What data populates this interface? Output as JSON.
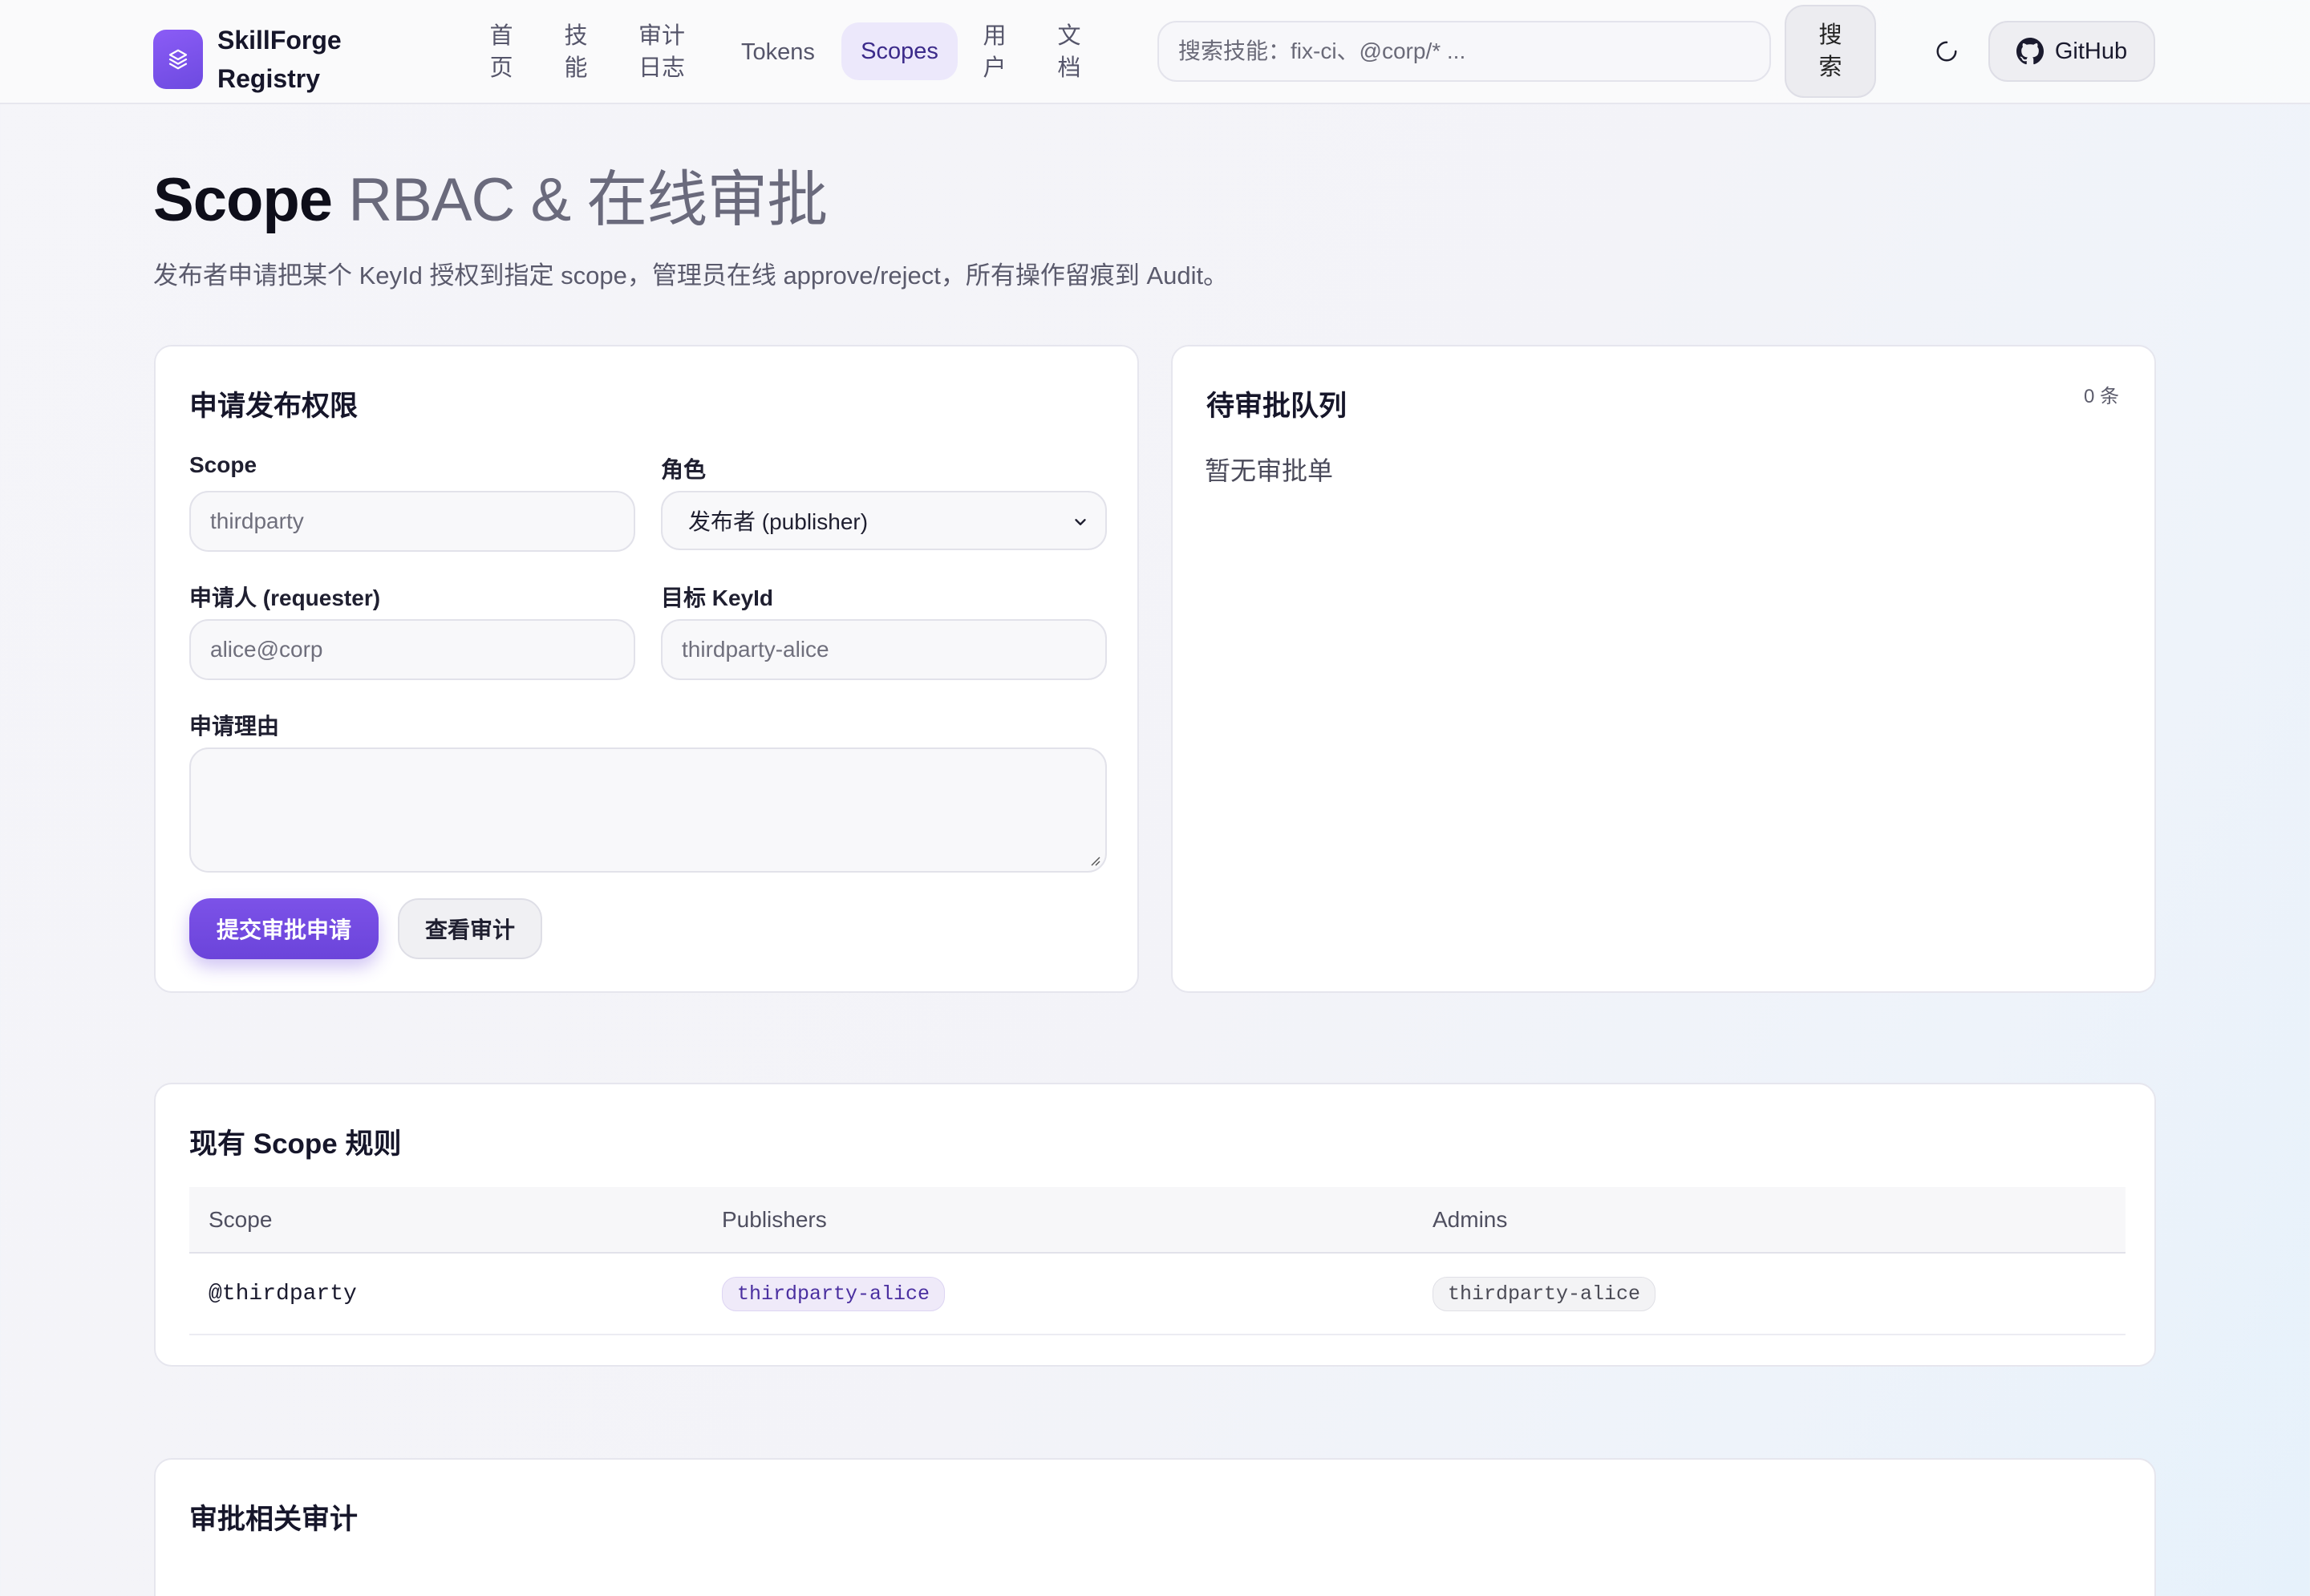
{
  "header": {
    "brand_name": "SkillForge\nRegistry",
    "nav": [
      {
        "label": "首\n页",
        "active": false
      },
      {
        "label": "技\n能",
        "active": false
      },
      {
        "label": "审计\n日志",
        "active": false
      },
      {
        "label": "Tokens",
        "active": false
      },
      {
        "label": "Scopes",
        "active": true
      },
      {
        "label": "用\n户",
        "active": false
      },
      {
        "label": "文\n档",
        "active": false
      }
    ],
    "search_placeholder": "搜索技能：fix-ci、@corp/* ...",
    "search_button": "搜\n索",
    "github_label": "GitHub"
  },
  "page": {
    "title_strong": "Scope",
    "title_light": " RBAC & 在线审批",
    "subtitle": "发布者申请把某个 KeyId 授权到指定 scope，管理员在线 approve/reject，所有操作留痕到 Audit。"
  },
  "request_form": {
    "title": "申请发布权限",
    "scope_label": "Scope",
    "scope_placeholder": "thirdparty",
    "role_label": "角色",
    "role_selected": "发布者 (publisher)",
    "requester_label": "申请人 (requester)",
    "requester_placeholder": "alice@corp",
    "target_label": "目标 KeyId",
    "target_placeholder": "thirdparty-alice",
    "reason_label": "申请理由",
    "submit_label": "提交审批申请",
    "view_audit_label": "查看审计"
  },
  "queue": {
    "title": "待审批队列",
    "count": "0 条",
    "empty_text": "暂无审批单"
  },
  "rules": {
    "title": "现有 Scope 规则",
    "columns": [
      "Scope",
      "Publishers",
      "Admins"
    ],
    "rows": [
      {
        "scope": "@thirdparty",
        "publisher": "thirdparty-alice",
        "admin": "thirdparty-alice"
      }
    ]
  },
  "audit": {
    "title": "审批相关审计"
  },
  "colors": {
    "accent": "#7c52e8",
    "accent_soft": "#ece8fb"
  },
  "icons": {
    "brand": "layers-icon",
    "theme": "moon-icon",
    "github": "github-icon",
    "select": "chevron-down-icon"
  }
}
